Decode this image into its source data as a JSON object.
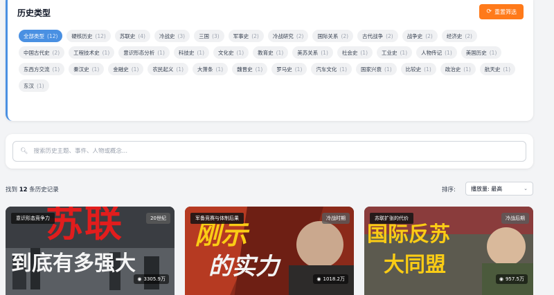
{
  "filter": {
    "title": "历史类型",
    "reset_label": "重置筛选",
    "tags": [
      {
        "label": "全部类型",
        "count": "(12)",
        "active": true
      },
      {
        "label": "硬核历史",
        "count": "(12)"
      },
      {
        "label": "苏联史",
        "count": "(4)"
      },
      {
        "label": "冷战史",
        "count": "(3)"
      },
      {
        "label": "三国",
        "count": "(3)"
      },
      {
        "label": "军事史",
        "count": "(2)"
      },
      {
        "label": "冷战研究",
        "count": "(2)"
      },
      {
        "label": "国际关系",
        "count": "(2)"
      },
      {
        "label": "古代战争",
        "count": "(2)"
      },
      {
        "label": "战争史",
        "count": "(2)"
      },
      {
        "label": "经济史",
        "count": "(2)"
      },
      {
        "label": "中国古代史",
        "count": "(2)"
      },
      {
        "label": "工程技术史",
        "count": "(1)"
      },
      {
        "label": "意识形态分析",
        "count": "(1)"
      },
      {
        "label": "科技史",
        "count": "(1)"
      },
      {
        "label": "文化史",
        "count": "(1)"
      },
      {
        "label": "教育史",
        "count": "(1)"
      },
      {
        "label": "美苏关系",
        "count": "(1)"
      },
      {
        "label": "社会史",
        "count": "(1)"
      },
      {
        "label": "工业史",
        "count": "(1)"
      },
      {
        "label": "人物传记",
        "count": "(1)"
      },
      {
        "label": "美国历史",
        "count": "(1)"
      },
      {
        "label": "东西方交流",
        "count": "(1)"
      },
      {
        "label": "秦汉史",
        "count": "(1)"
      },
      {
        "label": "金融史",
        "count": "(1)"
      },
      {
        "label": "农民起义",
        "count": "(1)"
      },
      {
        "label": "大萧条",
        "count": "(1)"
      },
      {
        "label": "魏晋史",
        "count": "(1)"
      },
      {
        "label": "罗马史",
        "count": "(1)"
      },
      {
        "label": "汽车文化",
        "count": "(1)"
      },
      {
        "label": "国家兴衰",
        "count": "(1)"
      },
      {
        "label": "比较史",
        "count": "(1)"
      },
      {
        "label": "政治史",
        "count": "(1)"
      },
      {
        "label": "航天史",
        "count": "(1)"
      },
      {
        "label": "东汉",
        "count": "(1)"
      }
    ]
  },
  "search": {
    "placeholder": "搜索历史主题、事件、人物或概念..."
  },
  "results": {
    "prefix": "找到",
    "count": "12",
    "suffix": "条历史记录"
  },
  "sort": {
    "label": "排序:",
    "selected": "播放量: 最高"
  },
  "cards": [
    {
      "category": "意识形态竞争力",
      "era": "20世纪",
      "views": "3305.9万",
      "title_line1": "苏联",
      "title_line2": "到底有多强大"
    },
    {
      "category": "军备竞赛与体制后果",
      "era": "冷战时期",
      "views": "1018.2万",
      "title_line1": "刚示",
      "title_line2": "的实力"
    },
    {
      "category": "苏联扩张的代价",
      "era": "冷战后期",
      "views": "957.5万",
      "title_line1": "国际反苏",
      "title_line2": "大同盟"
    }
  ],
  "colors": {
    "accent": "#4a90e2",
    "reset": "#ff7a1a"
  }
}
